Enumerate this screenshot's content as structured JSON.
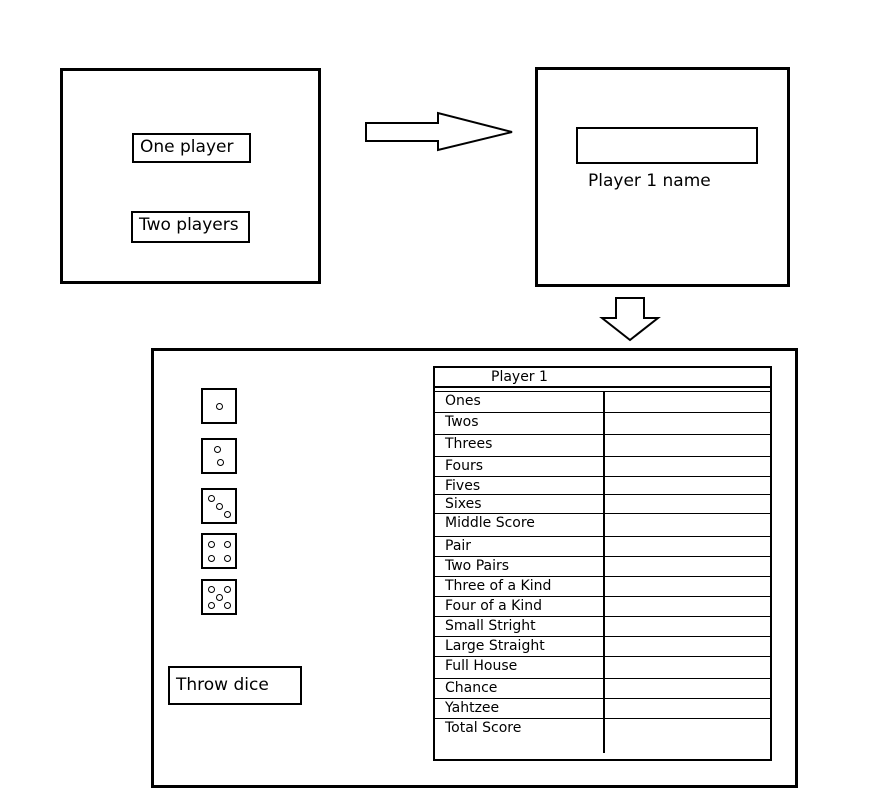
{
  "screen1": {
    "one_player": "One player",
    "two_players": "Two players"
  },
  "screen2": {
    "name_label": "Player 1 name",
    "name_value": ""
  },
  "screen3": {
    "dice": [
      1,
      2,
      3,
      4,
      5
    ],
    "throw_button": "Throw dice",
    "table_title": "Player 1",
    "rows": [
      {
        "name": "Ones",
        "value": ""
      },
      {
        "name": "Twos",
        "value": ""
      },
      {
        "name": "Threes",
        "value": ""
      },
      {
        "name": "Fours",
        "value": ""
      },
      {
        "name": "Fives",
        "value": ""
      },
      {
        "name": "Sixes",
        "value": ""
      },
      {
        "name": "Middle Score",
        "value": ""
      },
      {
        "name": "Pair",
        "value": ""
      },
      {
        "name": "Two Pairs",
        "value": ""
      },
      {
        "name": "Three of a Kind",
        "value": ""
      },
      {
        "name": "Four of a Kind",
        "value": ""
      },
      {
        "name": "Small Stright",
        "value": ""
      },
      {
        "name": "Large Straight",
        "value": ""
      },
      {
        "name": "Full House",
        "value": ""
      },
      {
        "name": "Chance",
        "value": ""
      },
      {
        "name": "Yahtzee",
        "value": ""
      },
      {
        "name": "Total Score",
        "value": ""
      }
    ]
  }
}
